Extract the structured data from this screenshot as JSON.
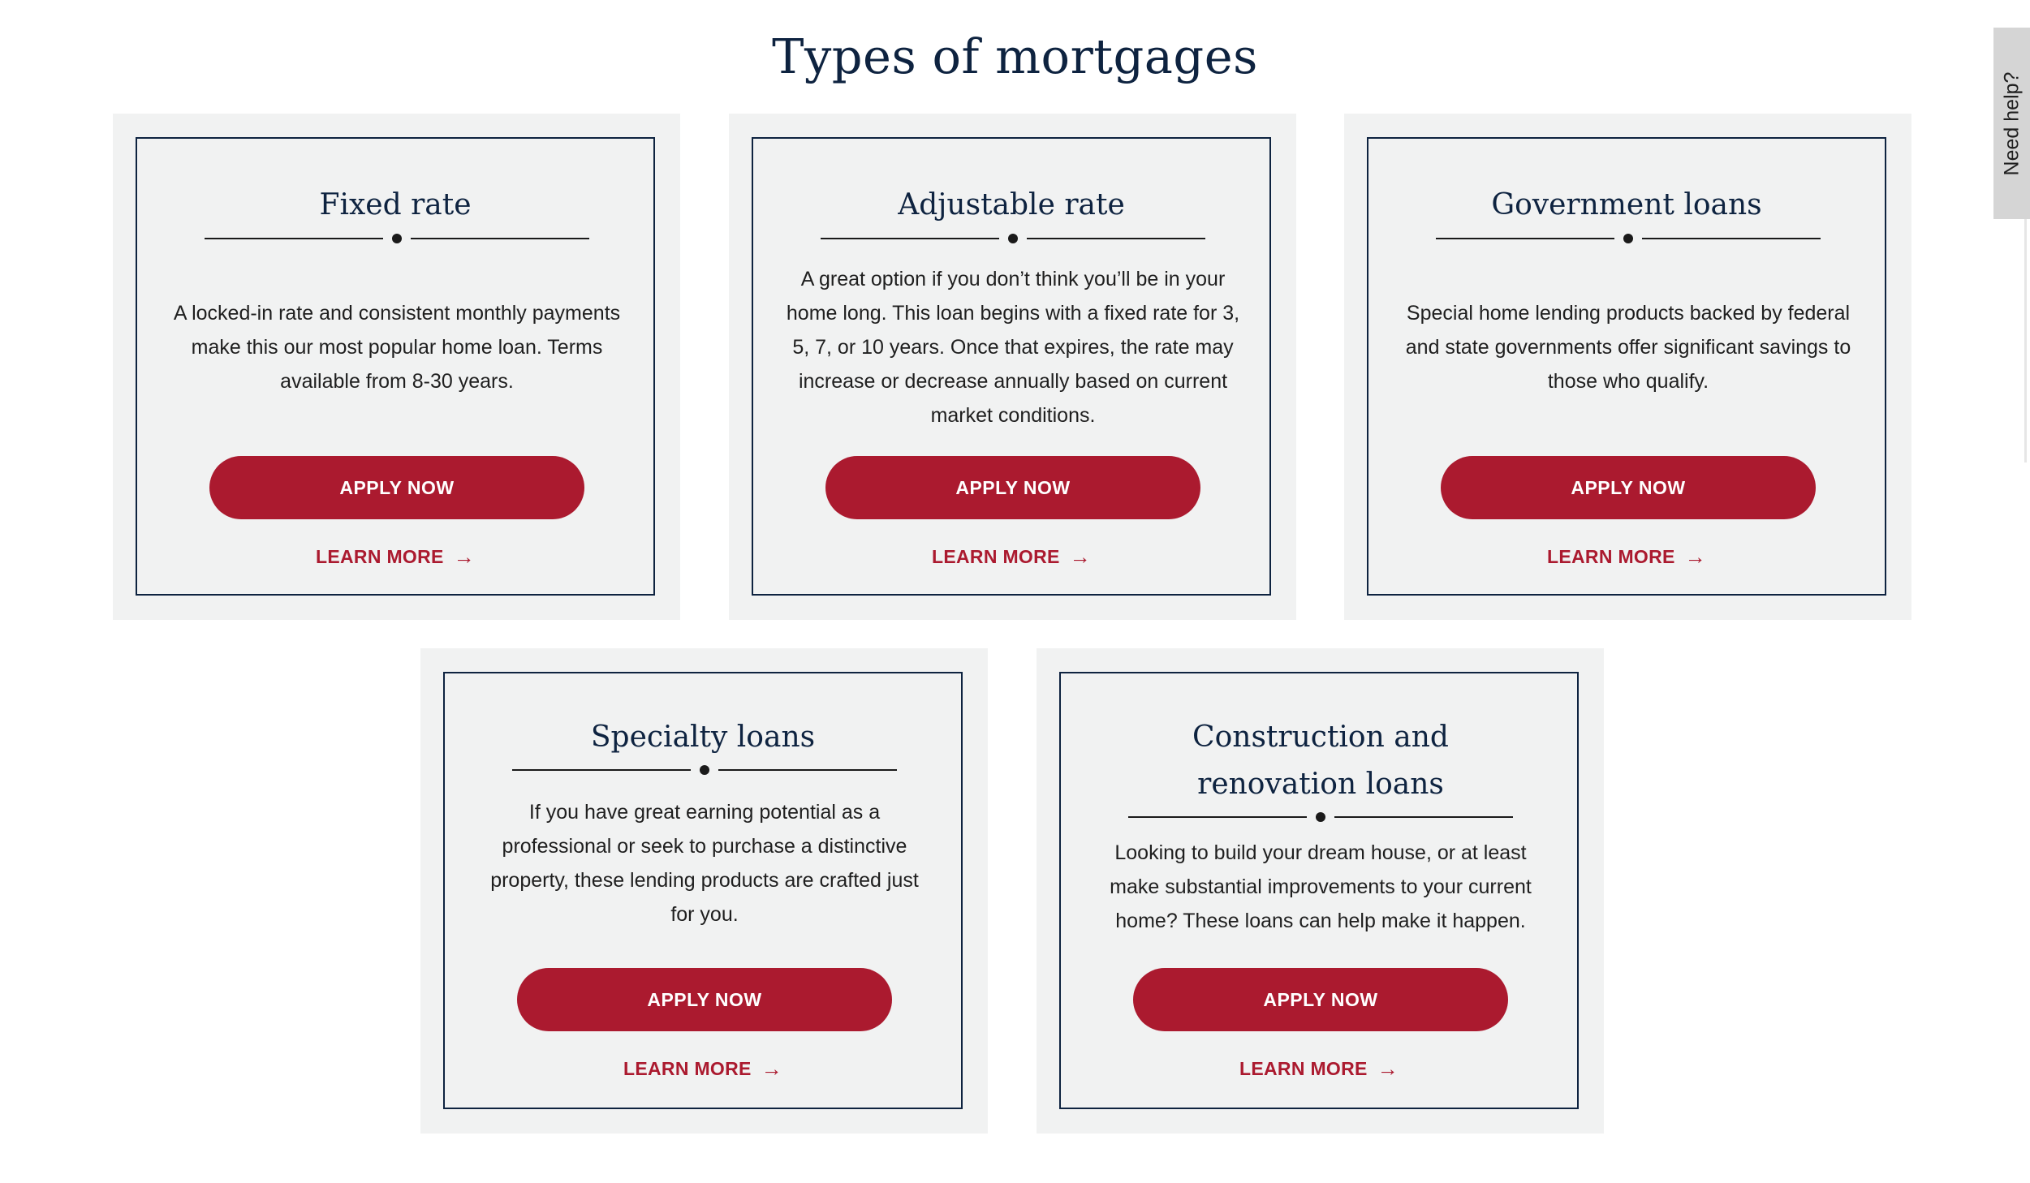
{
  "page": {
    "title": "Types of mortgages"
  },
  "cards": [
    {
      "title": "Fixed rate",
      "description": "A locked-in rate and consistent monthly payments make this our most popular home loan. Terms available from 8-30 years.",
      "apply_label": "APPLY NOW",
      "learn_label": "LEARN MORE"
    },
    {
      "title": "Adjustable rate",
      "description": "A great option if you don’t think you’ll be in your home long. This loan begins with a fixed rate for 3, 5, 7, or 10 years. Once that expires, the rate may increase or decrease annually based on current market conditions.",
      "apply_label": "APPLY NOW",
      "learn_label": "LEARN MORE"
    },
    {
      "title": "Government loans",
      "description": "Special home lending products backed by federal and state governments offer significant savings to those who qualify.",
      "apply_label": "APPLY NOW",
      "learn_label": "LEARN MORE"
    },
    {
      "title": "Specialty loans",
      "description": "If you have great earning potential as a professional or seek to purchase a distinctive property, these lending products are crafted just for you.",
      "apply_label": "APPLY NOW",
      "learn_label": "LEARN MORE"
    },
    {
      "title": "Construction and renovation loans",
      "description": "Looking to build your dream house, or at least make substantial improvements to your current home? These loans can help make it happen.",
      "apply_label": "APPLY NOW",
      "learn_label": "LEARN MORE"
    }
  ],
  "help_tab": {
    "label": "Need help?"
  },
  "icons": {
    "learn_arrow": "arrow-right-icon"
  },
  "colors": {
    "brand_red": "#ab1a2f",
    "navy": "#0e2340",
    "card_bg": "#f1f2f2"
  }
}
